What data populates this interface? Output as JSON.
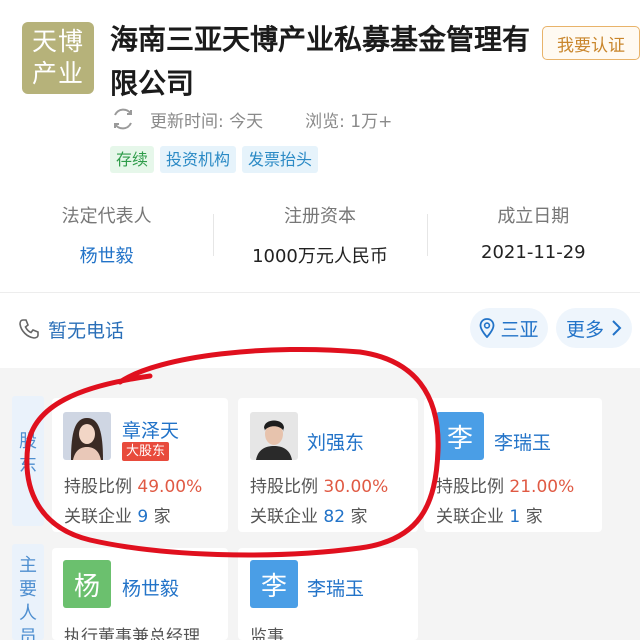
{
  "header": {
    "logo_line1": "天博",
    "logo_line2": "产业",
    "company_name": "海南三亚天博产业私募基金管理有限公司",
    "verify_button": "我要认证",
    "update_text": "更新时间: 今天",
    "views_text": "浏览: 1万+",
    "tags": [
      "存续",
      "投资机构",
      "发票抬头"
    ]
  },
  "info": [
    {
      "label": "法定代表人",
      "value": "杨世毅"
    },
    {
      "label": "注册资本",
      "value": "1000万元人民币"
    },
    {
      "label": "成立日期",
      "value": "2021-11-29"
    }
  ],
  "contact": {
    "phone": "暂无电话",
    "location": "三亚",
    "more": "更多"
  },
  "shareholders_tab": "股东",
  "shareholders": [
    {
      "name": "章泽天",
      "badge": "大股东",
      "ratio_label": "持股比例",
      "ratio": "49.00%",
      "assoc_label": "关联企业",
      "assoc_count": "9",
      "assoc_unit": "家"
    },
    {
      "name": "刘强东",
      "ratio_label": "持股比例",
      "ratio": "30.00%",
      "assoc_label": "关联企业",
      "assoc_count": "82",
      "assoc_unit": "家"
    },
    {
      "name": "李瑞玉",
      "avatar_char": "李",
      "ratio_label": "持股比例",
      "ratio": "21.00%",
      "assoc_label": "关联企业",
      "assoc_count": "1",
      "assoc_unit": "家"
    }
  ],
  "key_people_tab": "主要人员",
  "key_people": [
    {
      "name": "杨世毅",
      "avatar_char": "杨",
      "role": "执行董事兼总经理"
    },
    {
      "name": "李瑞玉",
      "avatar_char": "李",
      "role": "监事"
    }
  ],
  "colors": {
    "accent_blue": "#2273c8",
    "ratio_red": "#e05a44",
    "badge_red": "#e84b3c",
    "logo_olive": "#b6b27a",
    "annotation_red": "#e0101e"
  }
}
